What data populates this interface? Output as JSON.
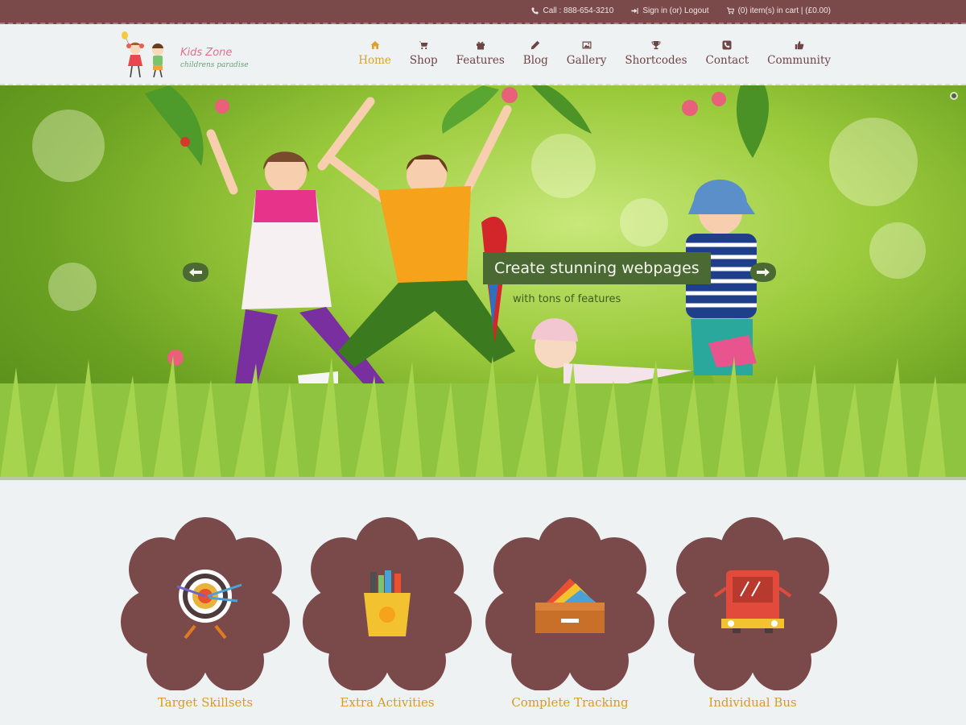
{
  "topbar": {
    "call": "Call : 888-654-3210",
    "account": "Sign in (or) Logout",
    "cart": "(0) item(s) in cart | (£0.00)"
  },
  "logo": {
    "brand": "Kids Zone",
    "tagline": "childrens paradise"
  },
  "nav": {
    "items": [
      {
        "label": "Home",
        "icon": "home-icon",
        "active": true
      },
      {
        "label": "Shop",
        "icon": "cart-icon"
      },
      {
        "label": "Features",
        "icon": "gift-icon"
      },
      {
        "label": "Blog",
        "icon": "pencil-icon"
      },
      {
        "label": "Gallery",
        "icon": "image-icon"
      },
      {
        "label": "Shortcodes",
        "icon": "trophy-icon"
      },
      {
        "label": "Contact",
        "icon": "phone-icon"
      },
      {
        "label": "Community",
        "icon": "thumbs-up-icon"
      }
    ]
  },
  "hero": {
    "caption_main": "Create stunning webpages",
    "caption_sub": "with tons of features"
  },
  "features": [
    {
      "title": "Target Skillsets",
      "icon": "target-icon"
    },
    {
      "title": "Extra Activities",
      "icon": "pencil-cup-icon"
    },
    {
      "title": "Complete Tracking",
      "icon": "drawer-icon"
    },
    {
      "title": "Individual Bus",
      "icon": "bus-icon"
    }
  ],
  "colors": {
    "brown": "#7a4a4b",
    "accent": "#e0a02f",
    "hero_green": "#6ca222",
    "caption_bg": "#4b6a33"
  }
}
